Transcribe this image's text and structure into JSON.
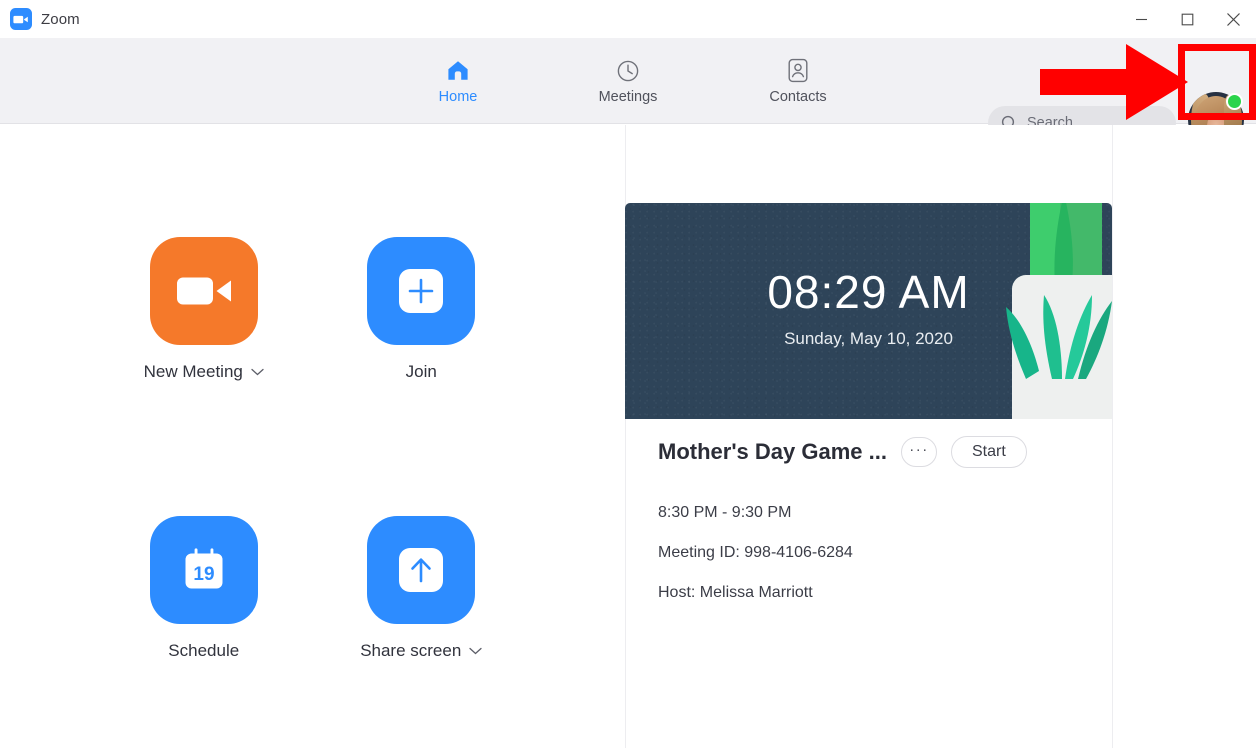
{
  "window": {
    "app_name": "Zoom",
    "logo_icon": "zoom-video-logo",
    "controls": {
      "minimize": "minimize-icon",
      "maximize": "maximize-icon",
      "close": "close-icon"
    }
  },
  "nav": {
    "tabs": [
      {
        "label": "Home",
        "icon": "home-icon",
        "active": true
      },
      {
        "label": "Meetings",
        "icon": "clock-icon",
        "active": false
      },
      {
        "label": "Contacts",
        "icon": "contact-card-icon",
        "active": false
      }
    ]
  },
  "search": {
    "placeholder": "Search",
    "icon": "search-icon"
  },
  "profile": {
    "avatar_name": "user-avatar",
    "status": "available",
    "status_color": "#2bd44b"
  },
  "settings": {
    "icon": "gear-icon"
  },
  "annotation": {
    "arrow_color": "#ff0000",
    "highlight_color": "#ff0000",
    "points_to": "profile-avatar"
  },
  "actions": [
    {
      "label": "New Meeting",
      "icon": "video-camera-icon",
      "color": "#f5792a",
      "has_dropdown": true
    },
    {
      "label": "Join",
      "icon": "plus-square-icon",
      "color": "#2d8cff",
      "has_dropdown": false
    },
    {
      "label": "Schedule",
      "icon": "calendar-icon",
      "calendar_day": "19",
      "color": "#2d8cff",
      "has_dropdown": false
    },
    {
      "label": "Share screen",
      "icon": "up-arrow-square-icon",
      "color": "#2d8cff",
      "has_dropdown": true
    }
  ],
  "clock": {
    "time": "08:29 AM",
    "date": "Sunday, May 10, 2020",
    "background_color": "#2e4459"
  },
  "meeting": {
    "title": "Mother's Day Game ...",
    "more_label": "···",
    "start_label": "Start",
    "time_range": "8:30 PM - 9:30 PM",
    "meeting_id": "Meeting ID: 998-4106-6284",
    "host": "Host: Melissa Marriott"
  }
}
